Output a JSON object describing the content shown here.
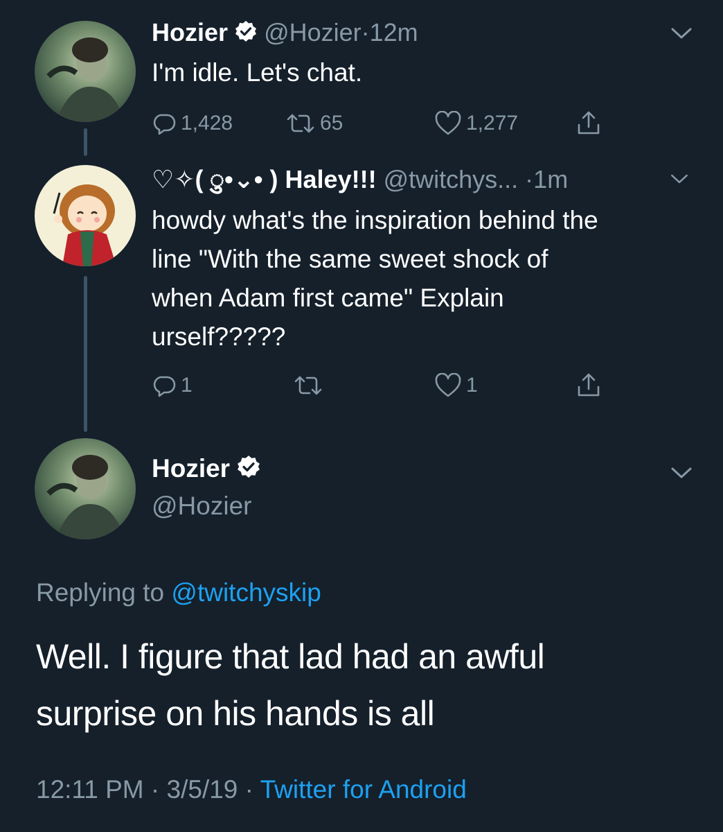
{
  "tweet1": {
    "name": "Hozier",
    "handle": "@Hozier",
    "dot": "·",
    "time": "12m",
    "text": "I'm idle. Let's chat.",
    "replies": "1,428",
    "retweets": "65",
    "likes": "1,277"
  },
  "tweet2": {
    "name": "♡✧( ु•⌄• ) Haley!!!",
    "handle": "@twitchys...",
    "dot": "·",
    "time": "1m",
    "text_lines": [
      "howdy what's the inspiration behind the",
      "line \"With the same sweet shock of",
      "when Adam first came\" Explain",
      "urself?????"
    ],
    "replies": "1",
    "likes": "1"
  },
  "tweet3": {
    "name": "Hozier",
    "handle": "@Hozier",
    "replying_prefix": "Replying to",
    "replying_handle": "@twitchyskip",
    "text_lines": [
      "Well. I figure that lad had an awful",
      "surprise on his hands is all"
    ],
    "time": "12:11 PM",
    "sep1": "·",
    "date": "3/5/19",
    "sep2": "·",
    "source": "Twitter for Android"
  },
  "colors": {
    "background": "#15202b",
    "secondary_text": "#8899a6",
    "link": "#1da1f2",
    "thread_line": "#3d5466"
  },
  "icons": [
    "verified-badge-icon",
    "chevron-down-icon",
    "reply-icon",
    "retweet-icon",
    "like-icon",
    "share-icon"
  ]
}
